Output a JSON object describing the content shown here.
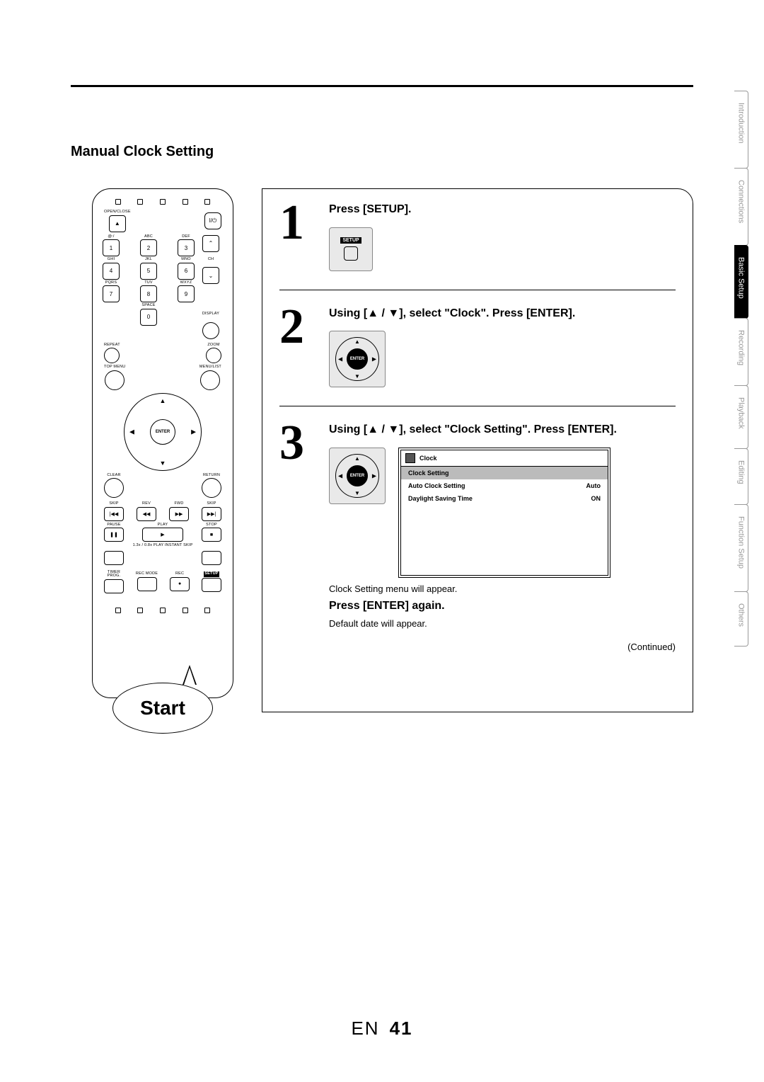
{
  "section_title": "Manual Clock Setting",
  "callout_label": "Start",
  "remote": {
    "open_close": "OPEN/CLOSE",
    "power_icon": "I/⏻",
    "keypad": {
      "row1_labels": [
        "@:/",
        "ABC",
        "DEF"
      ],
      "row1_nums": [
        "1",
        "2",
        "3"
      ],
      "row2_labels": [
        "GHI",
        "JKL",
        "MNO"
      ],
      "row2_nums": [
        "4",
        "5",
        "6"
      ],
      "row3_labels": [
        "PQRS",
        "TUV",
        "WXYZ"
      ],
      "row3_nums": [
        "7",
        "8",
        "9"
      ],
      "row4_label": "SPACE",
      "row4_num": "0",
      "ch_label": "CH",
      "display_label": "DISPLAY"
    },
    "labels": {
      "repeat": "REPEAT",
      "zoom": "ZOOM",
      "top_menu": "TOP MENU",
      "menu_list": "MENU/LIST",
      "clear": "CLEAR",
      "return": "RETURN",
      "skip": "SKIP",
      "rev": "REV",
      "fwd": "FWD",
      "skip2": "SKIP",
      "pause": "PAUSE",
      "play": "PLAY",
      "stop": "STOP",
      "speedline": "1.3x / 0.8x PLAY   INSTANT SKIP",
      "timer_prog": "TIMER\nPROG.",
      "rec_mode": "REC MODE",
      "rec": "REC",
      "setup": "SETUP"
    },
    "dpad_center": "ENTER"
  },
  "steps": {
    "s1": {
      "num": "1",
      "title": "Press [SETUP].",
      "btn_label": "SETUP"
    },
    "s2": {
      "num": "2",
      "title_pre": "Using [",
      "title_up": "▲",
      "title_mid": " / ",
      "title_down": "▼",
      "title_post": "], select \"Clock\". Press [ENTER].",
      "dpad_center": "ENTER"
    },
    "s3": {
      "num": "3",
      "title_pre": "Using [",
      "title_up": "▲",
      "title_mid": " / ",
      "title_down": "▼",
      "title_post": "], select \"Clock Setting\". Press [ENTER].",
      "dpad_center": "ENTER",
      "osd": {
        "title": "Clock",
        "items": [
          {
            "label": "Clock Setting",
            "value": "",
            "selected": true
          },
          {
            "label": "Auto Clock Setting",
            "value": "Auto",
            "selected": false
          },
          {
            "label": "Daylight Saving Time",
            "value": "ON",
            "selected": false
          }
        ]
      },
      "note1": "Clock Setting menu will appear.",
      "bold2": "Press [ENTER] again.",
      "note2": "Default date will appear."
    },
    "continued": "(Continued)"
  },
  "tabs": {
    "t1": "Introduction",
    "t2": "Connections",
    "t3": "Basic Setup",
    "t4": "Recording",
    "t5": "Playback",
    "t6": "Editing",
    "t7": "Function Setup",
    "t8": "Others"
  },
  "page": {
    "lang": "EN",
    "num": "41"
  }
}
